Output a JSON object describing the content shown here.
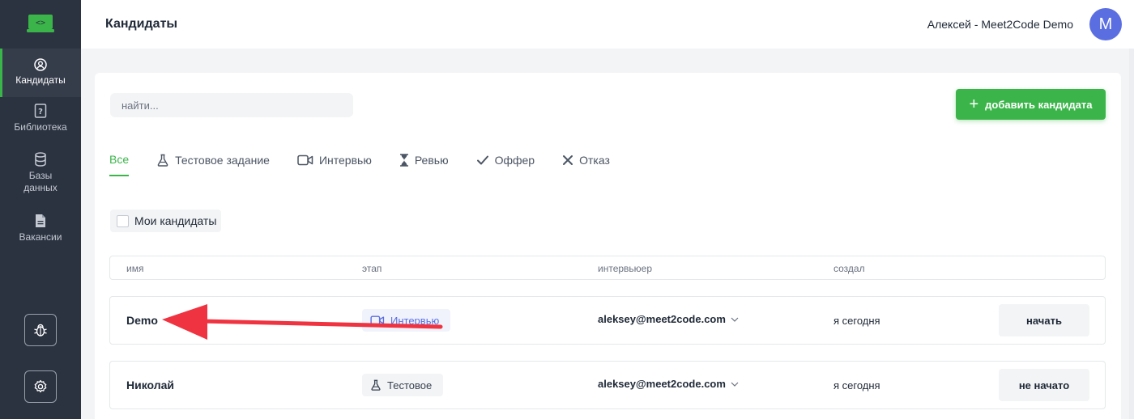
{
  "sidebar": {
    "items": [
      {
        "label": "Кандидаты",
        "icon": "user-circle-icon",
        "active": true
      },
      {
        "label": "Библиотека",
        "icon": "question-book-icon",
        "active": false
      },
      {
        "label": "Базы данных",
        "icon": "database-icon",
        "active": false
      },
      {
        "label": "Вакансии",
        "icon": "document-icon",
        "active": false
      }
    ],
    "bottom_buttons": [
      "bug-icon",
      "gear-icon"
    ]
  },
  "header": {
    "title": "Кандидаты",
    "user_name": "Алексей - Meet2Code Demo",
    "avatar_letter": "M"
  },
  "search": {
    "placeholder": "найти..."
  },
  "add_button": {
    "label": "добавить кандидата"
  },
  "tabs": [
    {
      "label": "Все",
      "active": true
    },
    {
      "label": "Тестовое задание",
      "icon": "flask-icon"
    },
    {
      "label": "Интервью",
      "icon": "video-icon"
    },
    {
      "label": "Ревью",
      "icon": "hourglass-icon"
    },
    {
      "label": "Оффер",
      "icon": "check-icon"
    },
    {
      "label": "Отказ",
      "icon": "x-icon"
    }
  ],
  "filter": {
    "my_candidates_label": "Мои кандидаты",
    "checked": false
  },
  "table": {
    "columns": [
      "имя",
      "этап",
      "интервьюер",
      "создал"
    ],
    "rows": [
      {
        "name": "Demo",
        "stage": "Интервью",
        "interviewer": "aleksey@meet2code.com",
        "created": "я сегодня",
        "action": "начать"
      },
      {
        "name": "Николай",
        "stage": "Тестовое",
        "interviewer": "aleksey@meet2code.com",
        "created": "я сегодня",
        "action": "не начато"
      }
    ]
  },
  "colors": {
    "accent_green": "#3bb54a",
    "sidebar_bg": "#2b3240",
    "avatar_bg": "#5b6ee1",
    "annotation_arrow": "#ef3340"
  }
}
